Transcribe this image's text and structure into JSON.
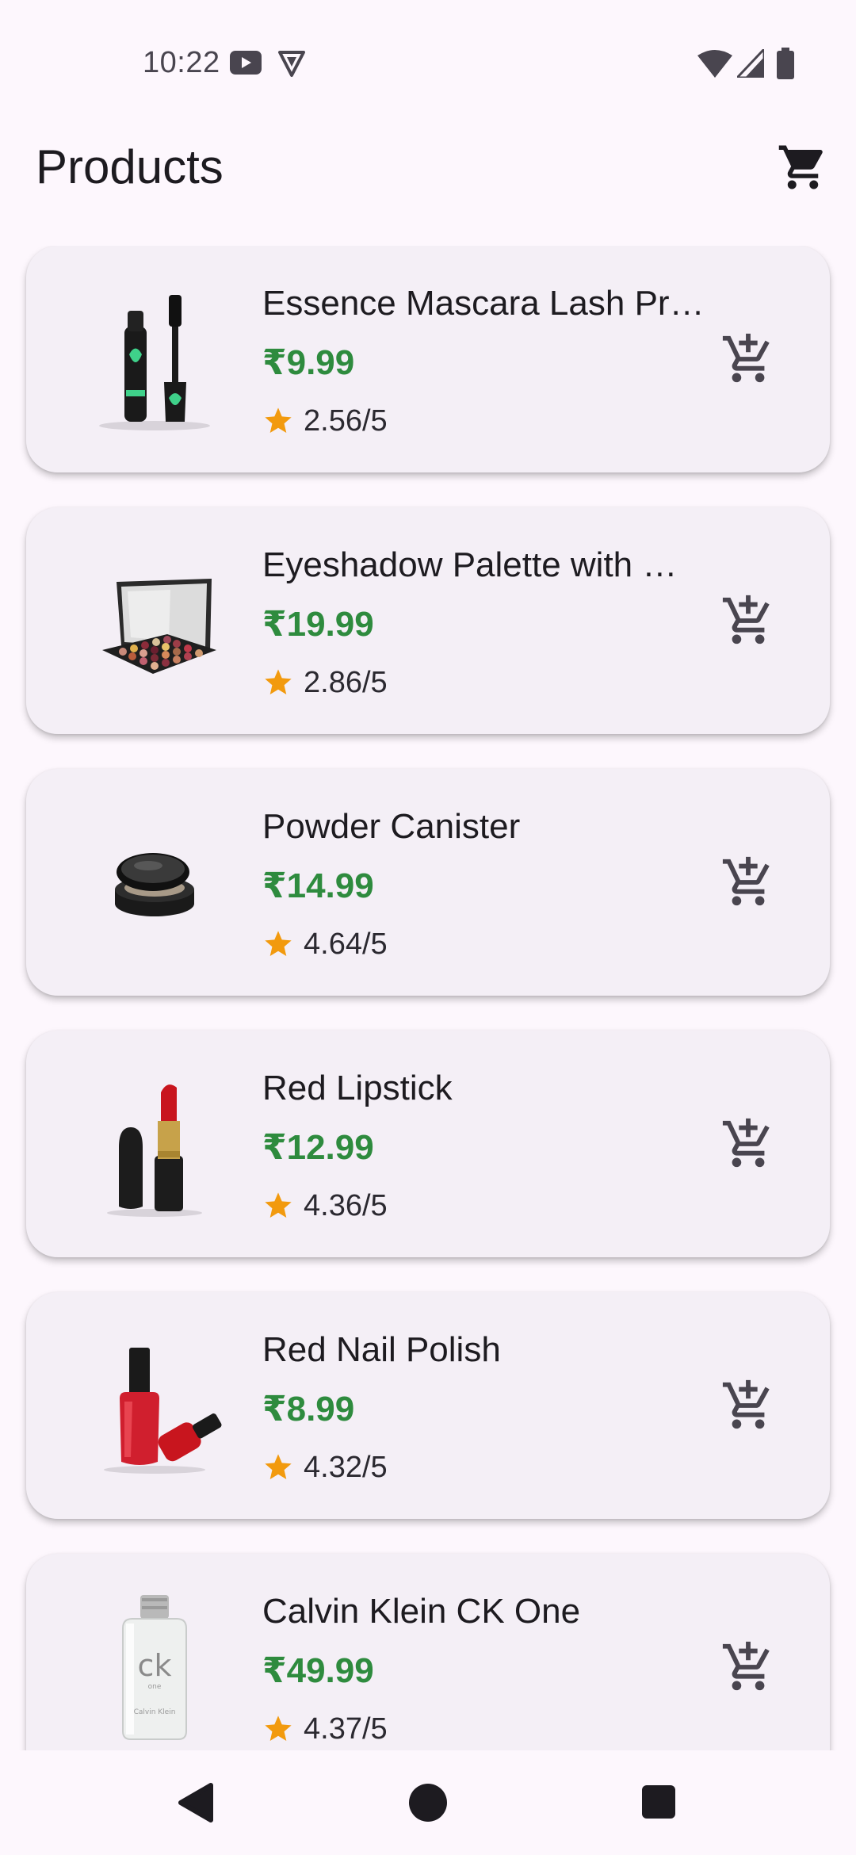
{
  "status_bar": {
    "time": "10:22",
    "icons": [
      "youtube-icon",
      "vpn-shield-icon",
      "wifi-icon",
      "cell-signal-icon",
      "battery-icon"
    ]
  },
  "app_bar": {
    "title": "Products",
    "cart_icon": "shopping-cart-icon"
  },
  "colors": {
    "background": "#fdf7fd",
    "card": "#f4eff6",
    "price": "#2e8b3e",
    "star": "#f29a0e",
    "text": "#1d1b20"
  },
  "products": [
    {
      "name": "Essence Mascara Lash Pr…",
      "price": "₹9.99",
      "rating": "2.56/5",
      "thumbnail": "mascara-image"
    },
    {
      "name": "Eyeshadow Palette with …",
      "price": "₹19.99",
      "rating": "2.86/5",
      "thumbnail": "eyeshadow-palette-image"
    },
    {
      "name": "Powder Canister",
      "price": "₹14.99",
      "rating": "4.64/5",
      "thumbnail": "powder-canister-image"
    },
    {
      "name": "Red Lipstick",
      "price": "₹12.99",
      "rating": "4.36/5",
      "thumbnail": "lipstick-image"
    },
    {
      "name": "Red Nail Polish",
      "price": "₹8.99",
      "rating": "4.32/5",
      "thumbnail": "nail-polish-image"
    },
    {
      "name": "Calvin Klein CK One",
      "price": "₹49.99",
      "rating": "4.37/5",
      "thumbnail": "perfume-bottle-image"
    }
  ],
  "thumbnail_text": {
    "ck_logo": "ck",
    "ck_sub": "one",
    "ck_brand": "Calvin Klein"
  },
  "nav_bar": {
    "icons": [
      "back-icon",
      "home-icon",
      "recents-icon"
    ]
  }
}
